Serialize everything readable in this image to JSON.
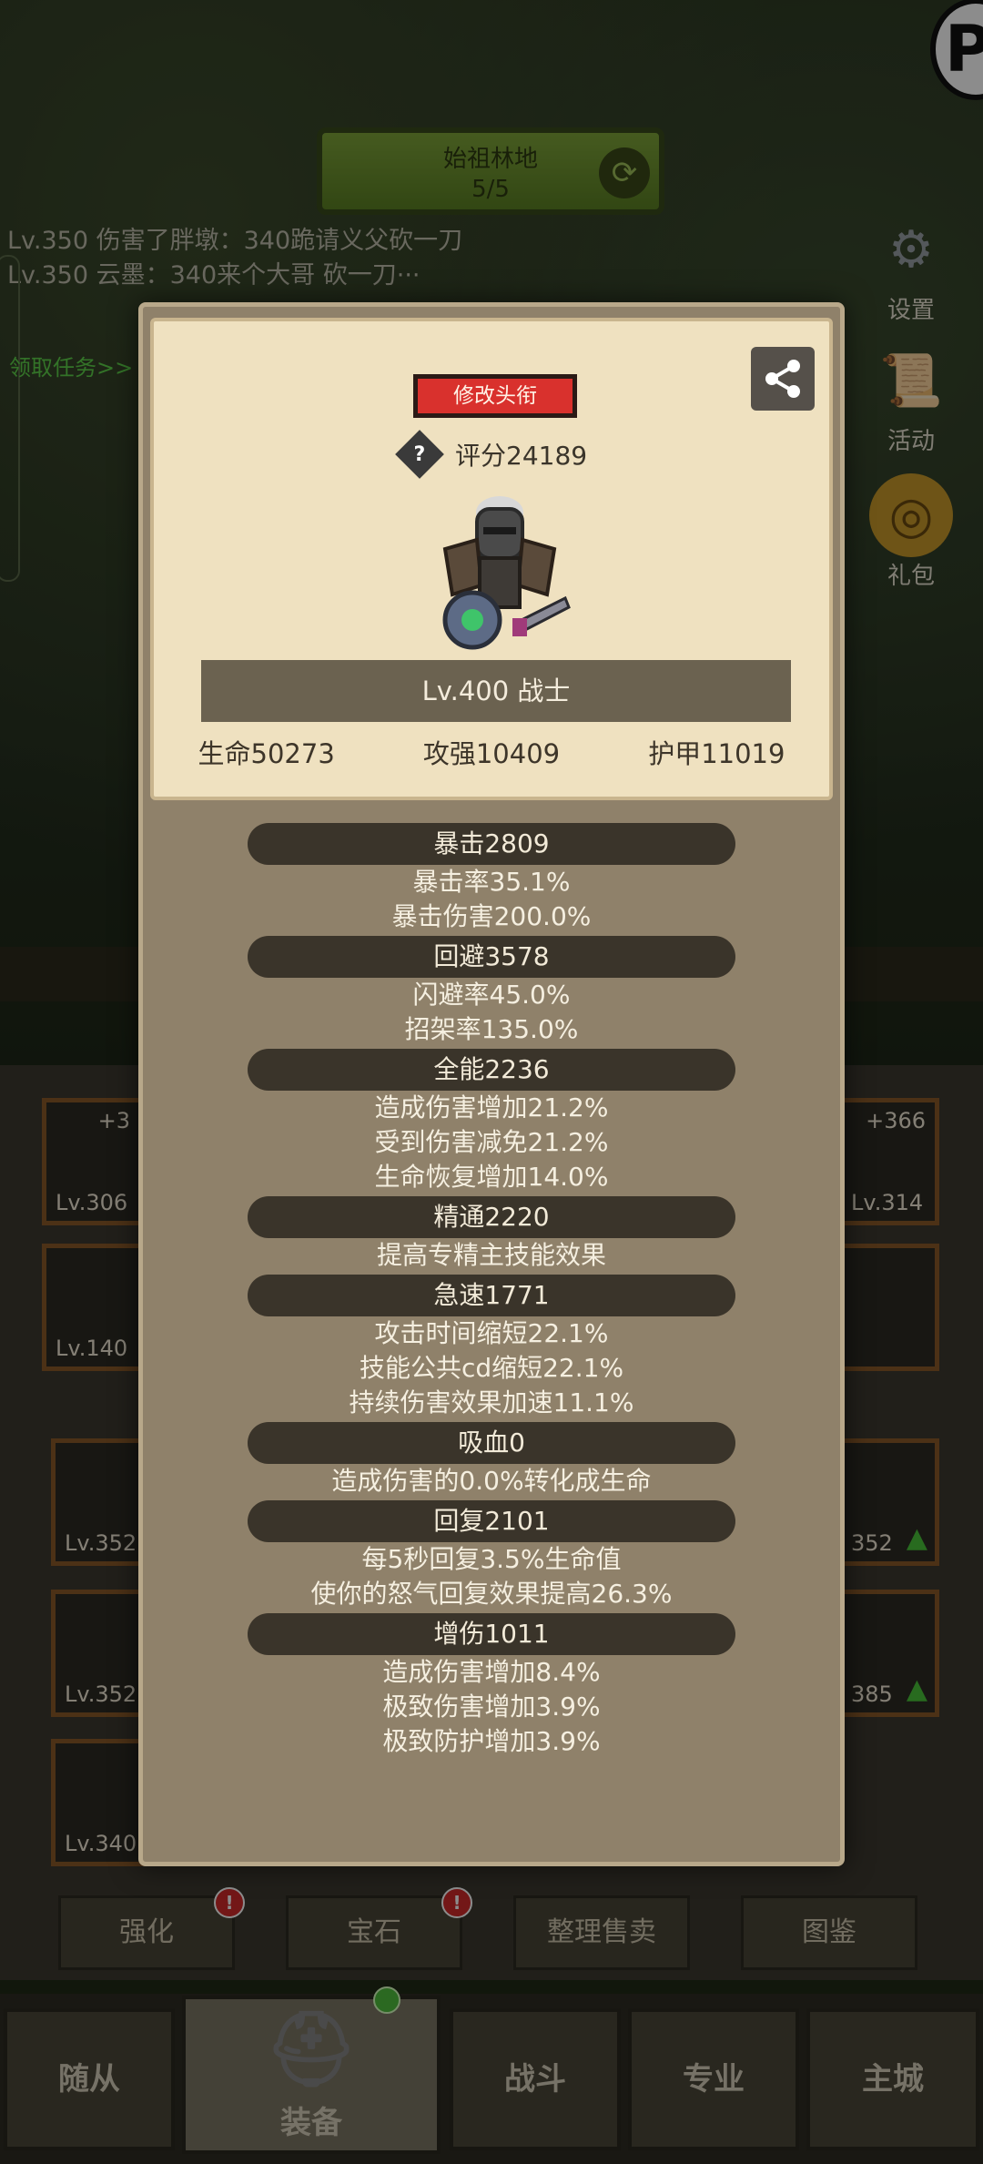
{
  "location": {
    "name": "始祖林地",
    "progress": "5/5"
  },
  "chat": [
    "Lv.350 伤害了胖墩：340跪请义父砍一刀",
    "Lv.350 云墨：340来个大哥 砍一刀···"
  ],
  "quest_link": "领取任务>>",
  "right_menu": {
    "settings": "设置",
    "activity": "活动",
    "gift": "礼包"
  },
  "popup": {
    "title_button": "修改头衔",
    "score": "评分24189",
    "level_class": "Lv.400 战士",
    "stats": {
      "hp": "生命50273",
      "attack": "攻强10409",
      "armor": "护甲11019"
    },
    "attributes": [
      {
        "head": "暴击2809",
        "lines": [
          "暴击率35.1%",
          "暴击伤害200.0%"
        ]
      },
      {
        "head": "回避3578",
        "lines": [
          "闪避率45.0%",
          "招架率135.0%"
        ]
      },
      {
        "head": "全能2236",
        "lines": [
          "造成伤害增加21.2%",
          "受到伤害减免21.2%",
          "生命恢复增加14.0%"
        ]
      },
      {
        "head": "精通2220",
        "lines": [
          "提高专精主技能效果"
        ]
      },
      {
        "head": "急速1771",
        "lines": [
          "攻击时间缩短22.1%",
          "技能公共cd缩短22.1%",
          "持续伤害效果加速11.1%"
        ]
      },
      {
        "head": "吸血0",
        "lines": [
          "造成伤害的0.0%转化成生命"
        ]
      },
      {
        "head": "回复2101",
        "lines": [
          "每5秒回复3.5%生命值",
          "使你的怒气回复效果提高26.3%"
        ]
      },
      {
        "head": "增伤1011",
        "lines": [
          "造成伤害增加8.4%",
          "极致伤害增加3.9%",
          "极致防护增加3.9%"
        ]
      }
    ]
  },
  "equipment_slots": {
    "left": [
      {
        "plus": "+3",
        "level": "Lv.306"
      },
      {
        "level": "Lv.140"
      },
      {
        "level": "Lv.352"
      },
      {
        "level": "Lv.352"
      },
      {
        "level": "Lv.340"
      }
    ],
    "right": [
      {
        "plus": "+366",
        "level": "Lv.314"
      },
      {
        "level": ""
      },
      {
        "level": "352"
      },
      {
        "level": "385"
      }
    ]
  },
  "actions": {
    "enhance": "强化",
    "gem": "宝石",
    "sort_sell": "整理售卖",
    "codex": "图鉴"
  },
  "nav": {
    "followers": "随从",
    "equipment": "装备",
    "battle": "战斗",
    "profession": "专业",
    "main_city": "主城"
  }
}
